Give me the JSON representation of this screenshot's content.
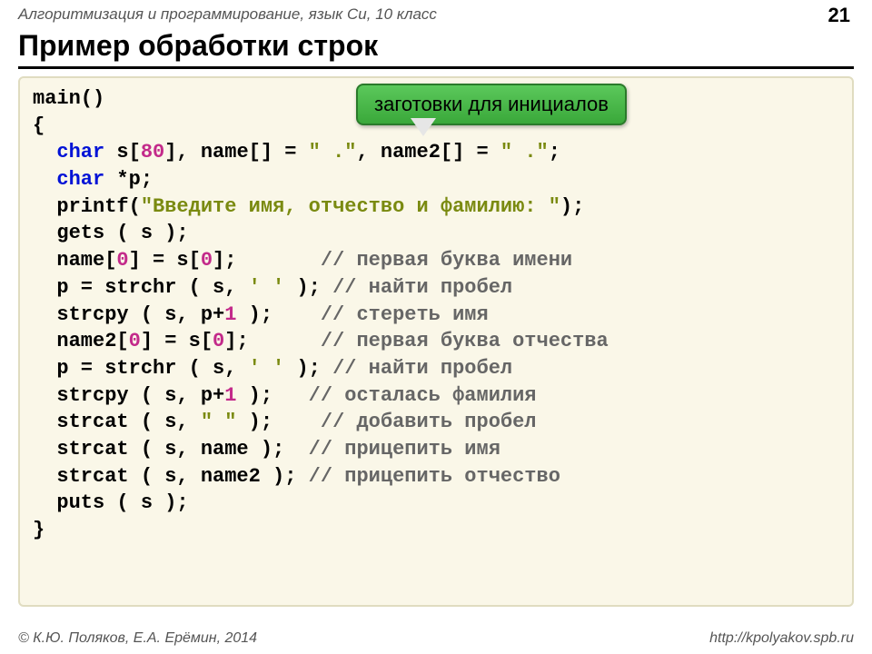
{
  "header": "Алгоритмизация и программирование, язык Си, 10 класс",
  "page_number": "21",
  "title": "Пример обработки строк",
  "callout": "заготовки для инициалов",
  "code": {
    "l1": "main()",
    "l2": "{",
    "l3a": "  ",
    "l3b": "char",
    "l3c": " s[",
    "l3d": "80",
    "l3e": "], name[] = ",
    "l3f": "\" .\"",
    "l3g": ", name2[] = ",
    "l3h": "\" .\"",
    "l3i": ";",
    "l4a": "  ",
    "l4b": "char",
    "l4c": " *p;",
    "l5a": "  printf(",
    "l5b": "\"Введите имя, отчество и фамилию: \"",
    "l5c": ");",
    "l6": "  gets ( s );",
    "l7a": "  name[",
    "l7b": "0",
    "l7c": "] = s[",
    "l7d": "0",
    "l7e": "];       ",
    "l7f": "// первая буква имени",
    "l8a": "  p = strchr ( s, ",
    "l8b": "' '",
    "l8c": " ); ",
    "l8d": "// найти пробел",
    "l9a": "  strcpy ( s, p+",
    "l9b": "1",
    "l9c": " );    ",
    "l9d": "// стереть имя",
    "l10a": "  name2[",
    "l10b": "0",
    "l10c": "] = s[",
    "l10d": "0",
    "l10e": "];      ",
    "l10f": "// первая буква отчества",
    "l11a": "  p = strchr ( s, ",
    "l11b": "' '",
    "l11c": " ); ",
    "l11d": "// найти пробел",
    "l12a": "  strcpy ( s, p+",
    "l12b": "1",
    "l12c": " );   ",
    "l12d": "// осталась фамилия",
    "l13a": "  strcat ( s, ",
    "l13b": "\" \"",
    "l13c": " );    ",
    "l13d": "// добавить пробел",
    "l14a": "  strcat ( s, name );  ",
    "l14b": "// прицепить имя",
    "l15a": "  strcat ( s, name2 ); ",
    "l15b": "// прицепить отчество",
    "l16": "  puts ( s );",
    "l17": "}"
  },
  "footer_left": "© К.Ю. Поляков, Е.А. Ерёмин, 2014",
  "footer_right": "http://kpolyakov.spb.ru"
}
